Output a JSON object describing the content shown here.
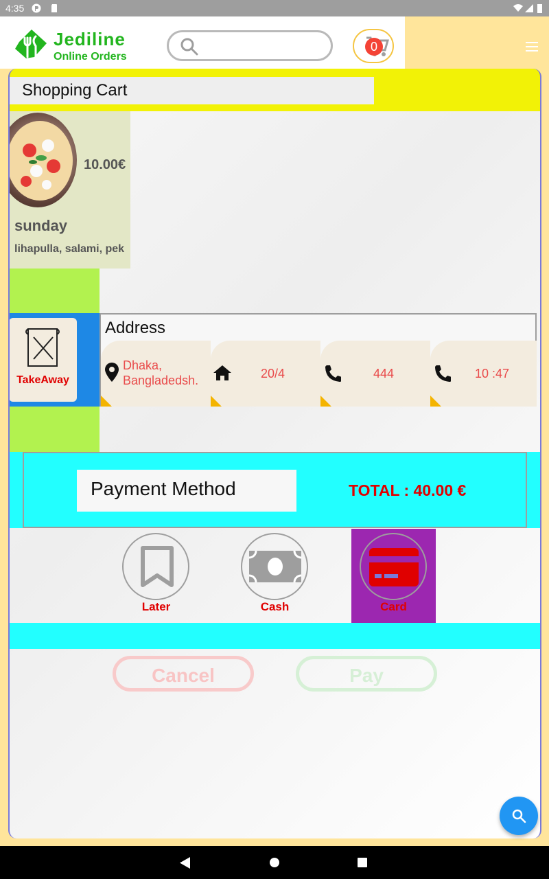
{
  "status_bar": {
    "time": "4:35"
  },
  "header": {
    "brand_name": "Jediline",
    "brand_sub": "Online Orders",
    "search_placeholder": "",
    "cart_count": "0"
  },
  "cart": {
    "title": "Shopping Cart",
    "item": {
      "price": "10.00€",
      "name": "sunday",
      "ingredients": "lihapulla, salami, peki"
    }
  },
  "order_type": {
    "label": "TakeAway"
  },
  "address": {
    "title": "Address",
    "city_line1": "Dhaka,",
    "city_line2": "Bangladedsh.",
    "house": "20/4",
    "phone": "444",
    "time": "10 :47"
  },
  "payment": {
    "title": "Payment Method",
    "total": "TOTAL : 40.00 €",
    "options": [
      {
        "label": "Later",
        "icon": "bookmark-icon",
        "selected": false
      },
      {
        "label": "Cash",
        "icon": "cash-icon",
        "selected": false
      },
      {
        "label": "Card",
        "icon": "credit-card-icon",
        "selected": true
      }
    ],
    "selected_color": "#9c27b0"
  },
  "actions": {
    "cancel_label": "Cancel",
    "pay_label": "Pay"
  },
  "colors": {
    "brand_green": "#22b51e",
    "accent_cyan": "#22ffff",
    "accent_yellow": "#f2f206",
    "accent_lime": "#b2f24f",
    "accent_blue": "#1e88e5",
    "error_red": "#e00000"
  }
}
